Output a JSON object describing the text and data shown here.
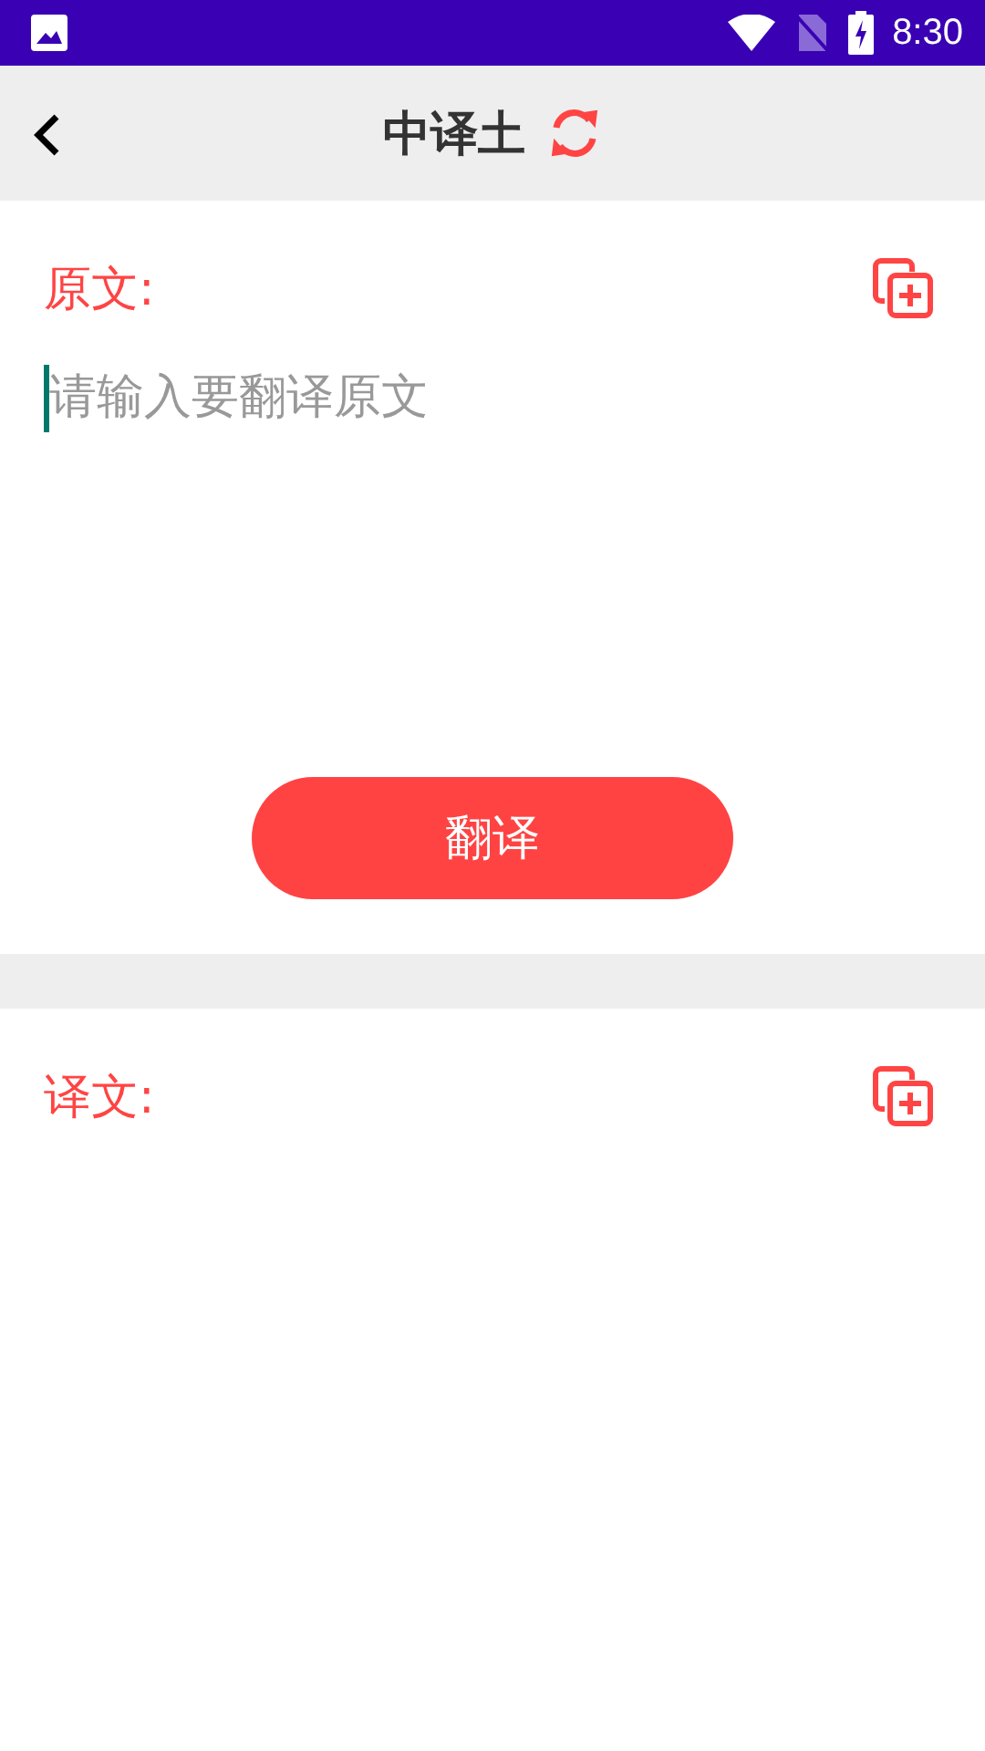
{
  "status_bar": {
    "time": "8:30"
  },
  "header": {
    "title": "中译土"
  },
  "source": {
    "label": "原文:",
    "placeholder": "请输入要翻译原文"
  },
  "translate_button": "翻译",
  "result": {
    "label": "译文:"
  }
}
